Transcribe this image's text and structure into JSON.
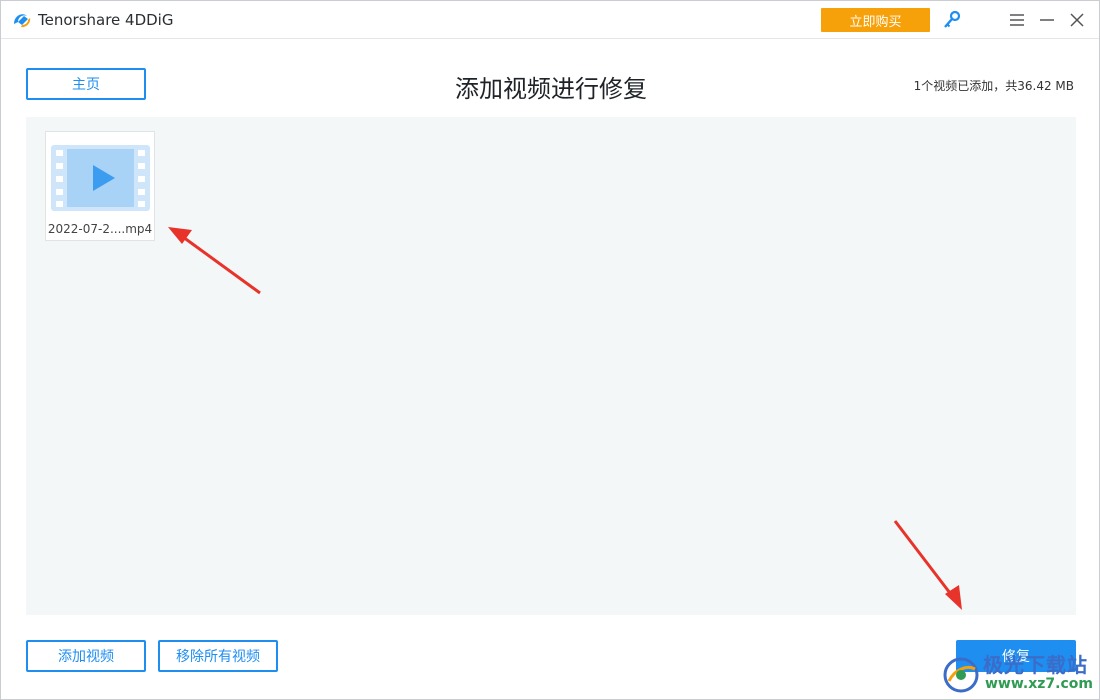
{
  "window": {
    "app_title": "Tenorshare 4DDiG",
    "buy_label": "立即购买"
  },
  "header": {
    "home_label": "主页",
    "page_title": "添加视频进行修复",
    "summary": "1个视频已添加，共36.42 MB"
  },
  "files": [
    {
      "name": "2022-07-2....mp4"
    }
  ],
  "footer": {
    "add_video_label": "添加视频",
    "remove_all_label": "移除所有视频",
    "repair_label": "修复"
  },
  "watermark": {
    "line1": "极光下载站",
    "line2": "www.xz7.com"
  },
  "colors": {
    "accent": "#1f8ef1",
    "buy": "#f7a10a",
    "area_bg": "#f3f7f8",
    "annotation": "#e8332a"
  },
  "icons": [
    "app-logo-icon",
    "key-icon",
    "menu-icon",
    "minimize-icon",
    "close-icon",
    "video-thumbnail-icon",
    "play-icon"
  ]
}
